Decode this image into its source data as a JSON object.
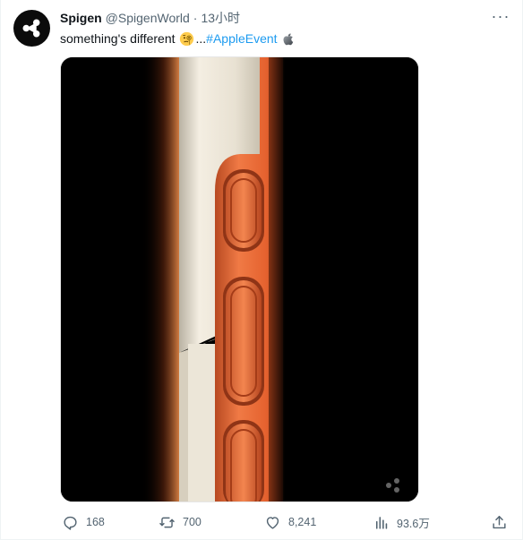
{
  "tweet": {
    "author_name": "Spigen",
    "author_handle": "@SpigenWorld",
    "separator": "·",
    "time": "13小时",
    "text_prefix": "something's different",
    "text_ellipsis": "...",
    "hashtag": "#AppleEvent",
    "more_label": "···"
  },
  "metrics": {
    "replies": "168",
    "retweets": "700",
    "likes": "8,241",
    "views": "93.6万"
  },
  "icons": {
    "avatar": "spigen-logo-icon",
    "emoji": "face-with-monocle-icon",
    "hashtag_badge": "apple-logo-icon",
    "reply": "reply-icon",
    "retweet": "retweet-icon",
    "like": "heart-icon",
    "views": "views-chart-icon",
    "share": "share-icon"
  },
  "colors": {
    "link": "#1d9bf0",
    "secondary_text": "#536471",
    "phone_frame": "#e8683a"
  }
}
